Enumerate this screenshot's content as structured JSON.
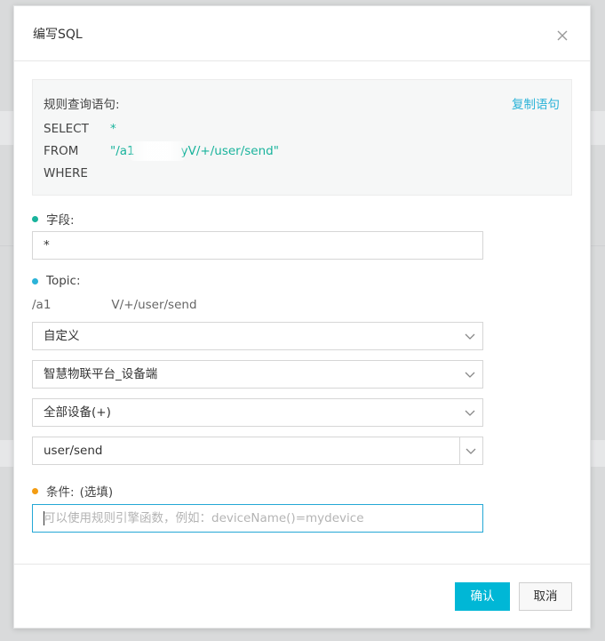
{
  "dialog": {
    "title": "编写SQL",
    "sql_label": "规则查询语句:",
    "copy_label": "复制语句",
    "select_keyword": "SELECT",
    "select_value": "*",
    "from_keyword": "FROM",
    "from_value_prefix": "\"/a1",
    "from_value_suffix": "yV/+/user/send\"",
    "where_keyword": "WHERE"
  },
  "fields": {
    "label": "字段:",
    "value": "*"
  },
  "topic": {
    "label": "Topic:",
    "path_prefix": "/a1",
    "path_suffix": "V/+/user/send",
    "type_select": "自定义",
    "product_select": "智慧物联平台_设备端",
    "device_select": "全部设备(+)",
    "topic_value": "user/send"
  },
  "condition": {
    "label": "条件:",
    "optional_label": "(选填)",
    "placeholder": "可以使用规则引擎函数，例如：deviceName()=mydevice"
  },
  "buttons": {
    "ok": "确认",
    "cancel": "取消"
  },
  "colors": {
    "accent": "#00b7d6",
    "link": "#2bb3d8",
    "sql_value": "#19b39c",
    "dot_green": "#19b39c",
    "dot_blue": "#2bb3d8",
    "dot_orange": "#f39c12"
  },
  "icons": {
    "close": "close-icon",
    "dropdown": "chevron-down-icon"
  }
}
